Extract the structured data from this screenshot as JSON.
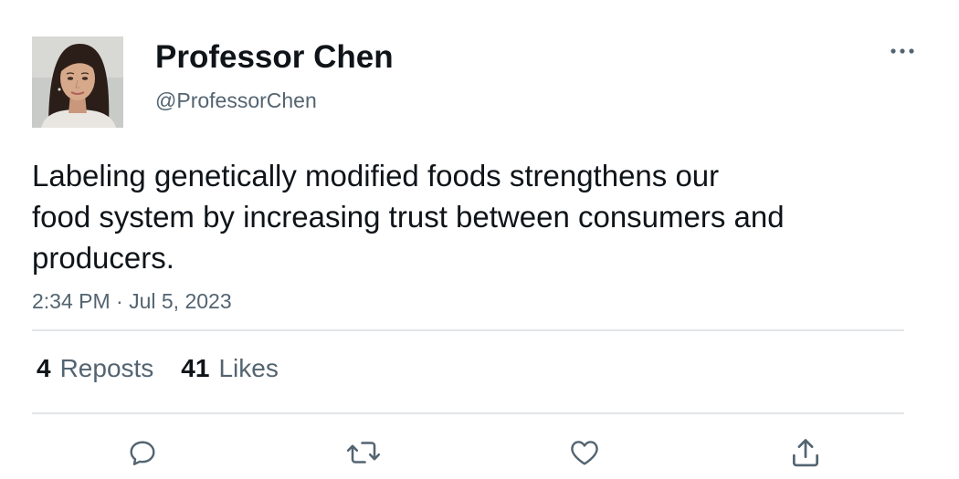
{
  "author": {
    "display_name": "Professor Chen",
    "handle": "@ProfessorChen"
  },
  "tweet": {
    "text_lines": [
      "Labeling genetically modified foods strengthens our",
      "food system by increasing trust between consumers and",
      "producers."
    ],
    "timestamp": "2:34 PM · Jul 5, 2023"
  },
  "stats": {
    "reposts_count": "4",
    "reposts_label": "Reposts",
    "likes_count": "41",
    "likes_label": "Likes"
  },
  "icons": {
    "more": "more-horizontal-icon",
    "reply": "reply-icon",
    "repost": "repost-icon",
    "like": "heart-icon",
    "share": "share-icon"
  },
  "colors": {
    "text_primary": "#0f1419",
    "text_secondary": "#536471",
    "divider": "#e3e6e8"
  }
}
